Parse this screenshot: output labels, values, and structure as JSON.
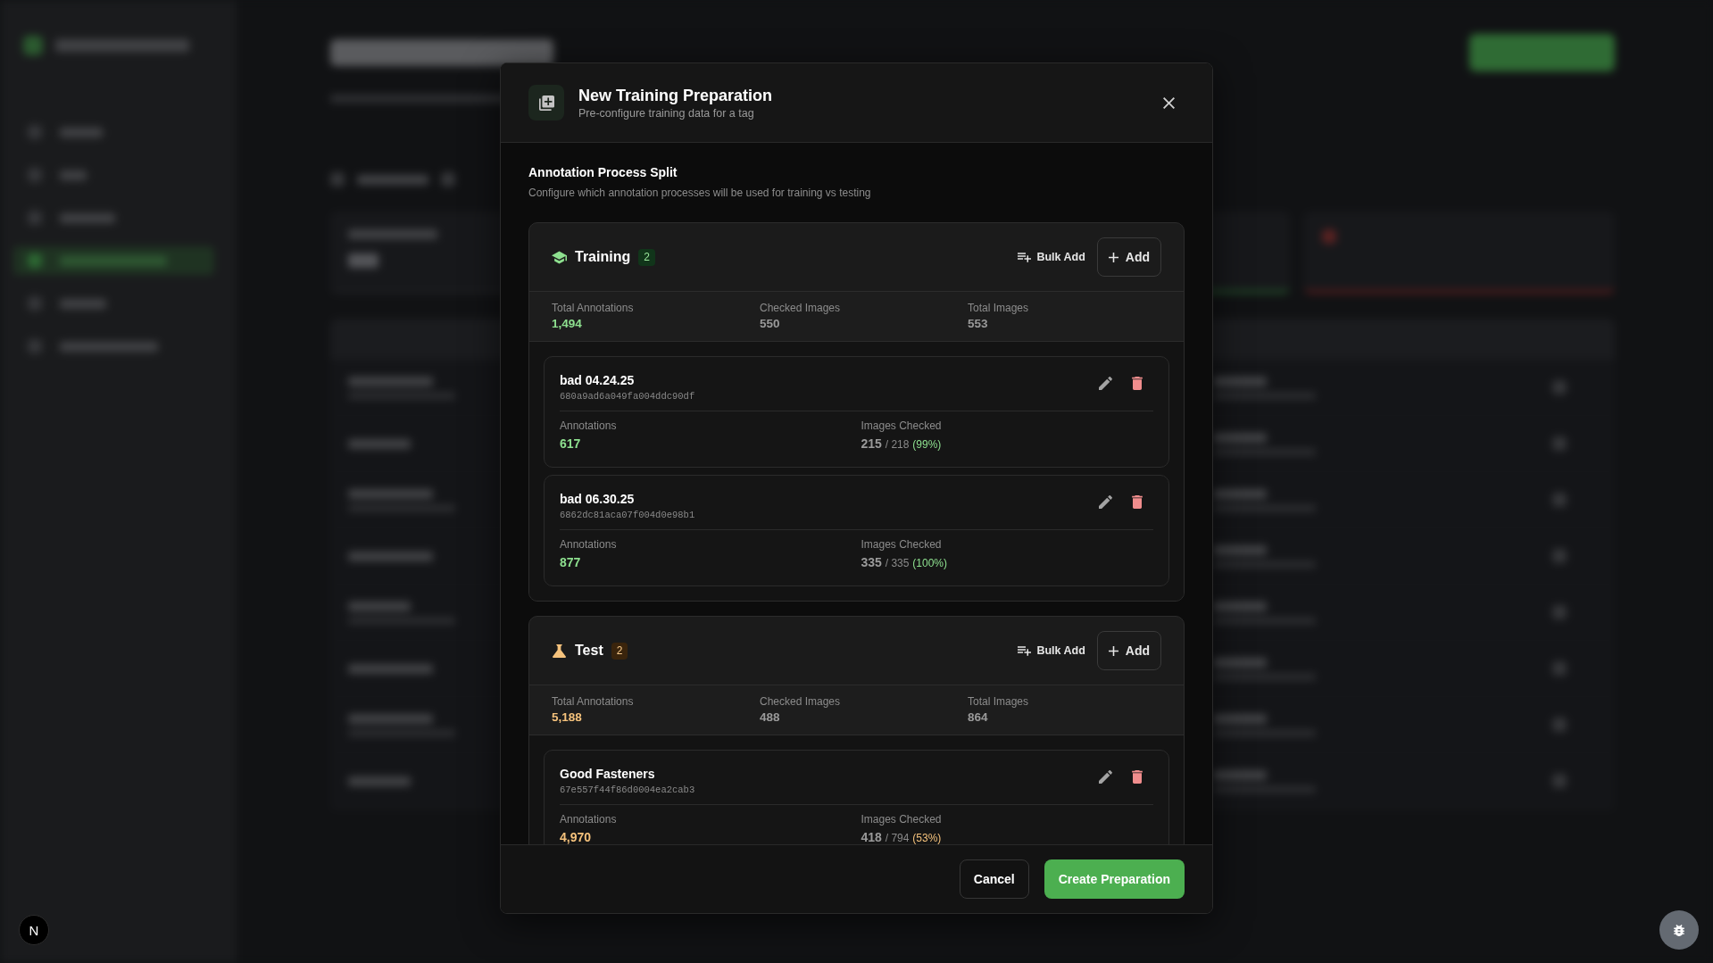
{
  "dialog": {
    "title": "New Training Preparation",
    "subtitle": "Pre-configure training data for a tag"
  },
  "split": {
    "heading": "Annotation Process Split",
    "description": "Configure which annotation processes will be used for training vs testing"
  },
  "sections": [
    {
      "kind": "training",
      "title": "Training",
      "count": "2",
      "bulk_add": "Bulk Add",
      "add": "Add",
      "stats": [
        {
          "label": "Total Annotations",
          "value": "1,494",
          "accent": true
        },
        {
          "label": "Checked Images",
          "value": "550",
          "accent": false
        },
        {
          "label": "Total Images",
          "value": "553",
          "accent": false
        }
      ],
      "processes": [
        {
          "name": "bad 04.24.25",
          "id": "680a9ad6a049fa004ddc90df",
          "annotations_label": "Annotations",
          "annotations": "617",
          "checked_label": "Images Checked",
          "checked": "215",
          "total": "/ 218",
          "percent": "(99%)"
        },
        {
          "name": "bad 06.30.25",
          "id": "6862dc81aca07f004d0e98b1",
          "annotations_label": "Annotations",
          "annotations": "877",
          "checked_label": "Images Checked",
          "checked": "335",
          "total": "/ 335",
          "percent": "(100%)"
        }
      ]
    },
    {
      "kind": "test",
      "title": "Test",
      "count": "2",
      "bulk_add": "Bulk Add",
      "add": "Add",
      "stats": [
        {
          "label": "Total Annotations",
          "value": "5,188",
          "accent": true
        },
        {
          "label": "Checked Images",
          "value": "488",
          "accent": false
        },
        {
          "label": "Total Images",
          "value": "864",
          "accent": false
        }
      ],
      "processes": [
        {
          "name": "Good Fasteners",
          "id": "67e557f44f86d0004ea2cab3",
          "annotations_label": "Annotations",
          "annotations": "4,970",
          "checked_label": "Images Checked",
          "checked": "418",
          "total": "/ 794",
          "percent": "(53%)"
        }
      ]
    }
  ],
  "footer": {
    "cancel": "Cancel",
    "create": "Create Preparation"
  },
  "dev_indicator": "N"
}
